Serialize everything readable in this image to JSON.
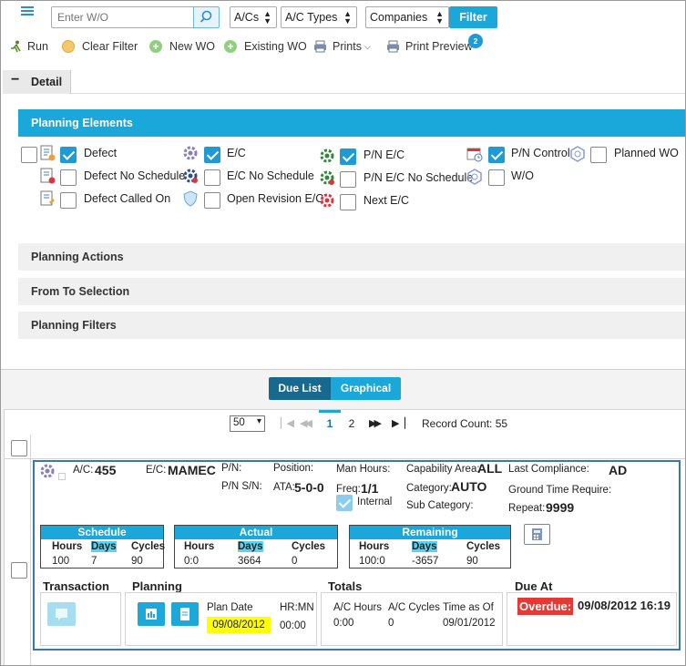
{
  "toolbar": {
    "search_placeholder": "Enter W/O",
    "acs_select": "A/Cs",
    "ac_types_select": "A/C Types",
    "companies_select": "Companies",
    "filter_label": "Filter",
    "run": "Run",
    "clear_filter": "Clear Filter",
    "new_wo": "New WO",
    "existing_wo": "Existing WO",
    "prints": "Prints",
    "print_preview": "Print Preview",
    "notification_count": "2"
  },
  "detail": {
    "toggle": "−",
    "title": "Detail",
    "planning_elements": "Planning Elements",
    "elements": [
      {
        "label": "Defect",
        "checked": true
      },
      {
        "label": "Defect No Schedule",
        "checked": false
      },
      {
        "label": "Defect Called On",
        "checked": false
      },
      {
        "label": "E/C",
        "checked": true
      },
      {
        "label": "E/C No Schedule",
        "checked": false
      },
      {
        "label": "Open Revision E/C",
        "checked": false
      },
      {
        "label": "P/N E/C",
        "checked": true
      },
      {
        "label": "P/N E/C No Schedule",
        "checked": false
      },
      {
        "label": "Next E/C",
        "checked": false
      },
      {
        "label": "P/N Control",
        "checked": true
      },
      {
        "label": "W/O",
        "checked": false
      },
      {
        "label": "Planned WO",
        "checked": false
      }
    ],
    "planning_actions": "Planning Actions",
    "from_to_selection": "From To Selection",
    "planning_filters": "Planning Filters"
  },
  "view_tabs": {
    "due_list": "Due List",
    "graphical": "Graphical",
    "active": "Due List"
  },
  "pagination": {
    "page_size": "50",
    "first": "⏮",
    "prev": "«",
    "pages": [
      "1",
      "2"
    ],
    "current": "1",
    "next": "»",
    "last": "⏭",
    "record_count": "Record Count: 55"
  },
  "record": {
    "ac_label": "A/C:",
    "ac": "455",
    "ec_label": "E/C:",
    "ec": "MAMEC",
    "pn_label": "P/N:",
    "pn": "",
    "pnsn_label": "P/N S/N:",
    "pnsn": "",
    "position_label": "Position:",
    "position": "",
    "ata_label": "ATA:",
    "ata": "5-0-0",
    "man_hours_label": "Man Hours:",
    "man_hours": "",
    "freq_label": "Freq:",
    "freq": "1/1",
    "internal_label": "Internal",
    "capability_label": "Capability Area:",
    "capability": "ALL",
    "category_label": "Category:",
    "category": "AUTO",
    "subcategory_label": "Sub Category:",
    "subcategory": "",
    "last_compliance_label": "Last Compliance:",
    "last_compliance": "AD",
    "ground_time_label": "Ground Time Require:",
    "ground_time": "",
    "repeat_label": "Repeat:",
    "repeat": "9999",
    "schedule": {
      "title": "Schedule",
      "headers": [
        "Hours",
        "Days",
        "Cycles"
      ],
      "values": [
        "100",
        "7",
        "90"
      ]
    },
    "actual": {
      "title": "Actual",
      "headers": [
        "Hours",
        "Days",
        "Cycles"
      ],
      "values": [
        "0:0",
        "3664",
        "0"
      ]
    },
    "remaining": {
      "title": "Remaining",
      "headers": [
        "Hours",
        "Days",
        "Cycles"
      ],
      "values": [
        "100:0",
        "-3657",
        "90"
      ]
    },
    "transaction_title": "Transaction",
    "planning_title": "Planning",
    "plan_date_label": "Plan Date",
    "plan_date": "09/08/2012",
    "hrmn_label": "HR:MN",
    "hrmn": "00:00",
    "totals_title": "Totals",
    "ac_hours_label": "A/C Hours",
    "ac_hours": "0:00",
    "ac_cycles_label": "A/C Cycles",
    "ac_cycles": "0",
    "time_as_of_label": "Time as Of",
    "time_as_of": "09/01/2012",
    "due_at_title": "Due At",
    "overdue_label": "Overdue:",
    "due_at": "09/08/2012 16:19"
  },
  "colors": {
    "accent": "#1aa7d9",
    "dark_tab": "#17698f",
    "highlight_yellow": "#ffff00",
    "overdue_red": "#e53935",
    "record_border": "#3a78b5"
  }
}
